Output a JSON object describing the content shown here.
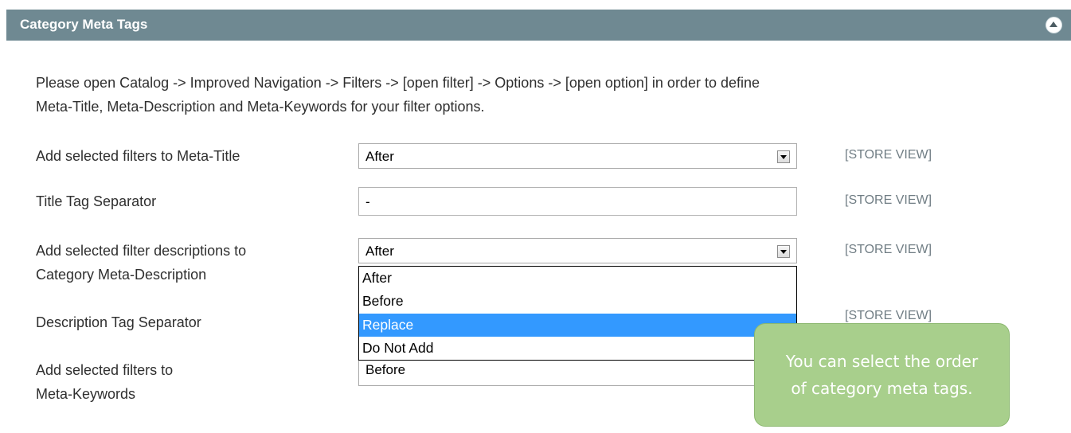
{
  "header": {
    "title": "Category Meta Tags"
  },
  "intro": {
    "line1": "Please open Catalog -> Improved Navigation -> Filters -> [open filter] -> Options -> [open option] in order to define",
    "line2": "Meta-Title, Meta-Description and Meta-Keywords for your filter options."
  },
  "fields": {
    "meta_title": {
      "label": "Add selected filters to Meta-Title",
      "value": "After",
      "scope": "[STORE VIEW]"
    },
    "title_separator": {
      "label": "Title Tag Separator",
      "value": "-",
      "scope": "[STORE VIEW]"
    },
    "meta_description": {
      "label_line1": "Add selected filter descriptions to",
      "label_line2": "Category Meta-Description",
      "value": "After",
      "scope": "[STORE VIEW]"
    },
    "description_separator": {
      "label": "Description Tag Separator",
      "scope": "[STORE VIEW]"
    },
    "meta_keywords": {
      "label_line1": "Add selected filters to",
      "label_line2": "Meta-Keywords",
      "value": "Before"
    }
  },
  "dropdown": {
    "options": [
      "After",
      "Before",
      "Replace",
      "Do Not Add"
    ],
    "highlighted": "Replace"
  },
  "tooltip": {
    "line1": "You can select the order",
    "line2": "of category meta tags."
  },
  "colors": {
    "header_bg": "#6f8992",
    "tooltip_bg": "#a8cf8c",
    "highlight": "#3399ff"
  }
}
